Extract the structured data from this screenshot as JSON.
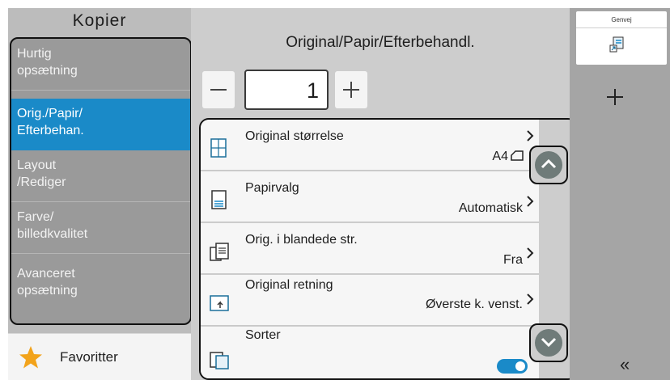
{
  "sidebar": {
    "title": "Kopier",
    "items": [
      {
        "line1": "Hurtig",
        "line2": "opsætning",
        "active": false
      },
      {
        "line1": "Orig./Papir/",
        "line2": "Efterbehan.",
        "active": true
      },
      {
        "line1": "Layout",
        "line2": "/Rediger",
        "active": false
      },
      {
        "line1": "Farve/",
        "line2": "billedkvalitet",
        "active": false
      },
      {
        "line1": "Avanceret",
        "line2": "opsætning",
        "active": false
      }
    ],
    "favorites_label": "Favoritter"
  },
  "main": {
    "title": "Original/Papir/Efterbehandl.",
    "quantity": "1",
    "settings": [
      {
        "label": "Original størrelse",
        "value": "A4",
        "icon": "original-size-icon"
      },
      {
        "label": "Papirvalg",
        "value": "Automatisk",
        "icon": "paper-select-icon"
      },
      {
        "label": "Orig. i blandede str.",
        "value": "Fra",
        "icon": "mixed-size-icon"
      },
      {
        "label": "Original retning",
        "value": "Øverste k. venst.",
        "icon": "orientation-icon"
      },
      {
        "label": "Sorter",
        "value": "",
        "icon": "collate-icon",
        "toggle_on": true
      }
    ]
  },
  "right_panel": {
    "shortcut_label": "Genvej",
    "add_label": "+",
    "collapse_label": "«"
  },
  "colors": {
    "accent": "#1a8ac8",
    "sidebar_bg": "#9a9a9a",
    "main_bg": "#cdcdcd",
    "right_bg": "#a5a5a5"
  }
}
